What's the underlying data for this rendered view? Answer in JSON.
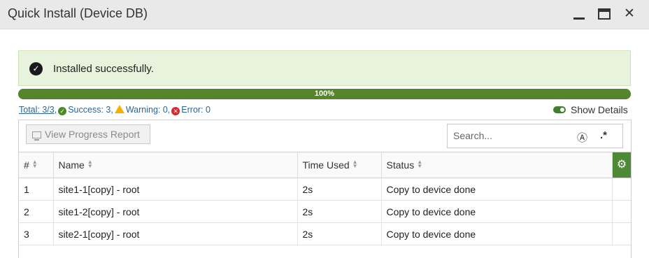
{
  "window": {
    "title": "Quick Install (Device DB)"
  },
  "banner": {
    "message": "Installed successfully."
  },
  "progress": {
    "label": "100%",
    "value": 1.0
  },
  "summary": {
    "total": "Total: 3/3,",
    "success": "Success: 3,",
    "warning": "Warning: 0,",
    "error": "Error: 0"
  },
  "show_details": {
    "label": "Show Details",
    "on": true
  },
  "toolbar": {
    "report_label": "View Progress Report"
  },
  "search": {
    "placeholder": "Search...",
    "value": ""
  },
  "table": {
    "headers": {
      "num": "#",
      "name": "Name",
      "time": "Time Used",
      "status": "Status"
    },
    "rows": [
      {
        "num": "1",
        "name": "site1-1[copy] - root",
        "time": "2s",
        "status": "Copy to device done"
      },
      {
        "num": "2",
        "name": "site1-2[copy] - root",
        "time": "2s",
        "status": "Copy to device done"
      },
      {
        "num": "3",
        "name": "site2-1[copy] - root",
        "time": "2s",
        "status": "Copy to device done"
      }
    ]
  },
  "colors": {
    "success": "#5b8a2a",
    "banner_bg": "#e7f3dc",
    "warning": "#f2b300",
    "error": "#d9262c",
    "link": "#2a6496"
  },
  "icons": [
    "minimize-icon",
    "maximize-icon",
    "close-icon",
    "check-circle-icon",
    "warning-icon",
    "error-icon",
    "monitor-icon",
    "search-icon",
    "regex-icon",
    "gear-icon"
  ]
}
